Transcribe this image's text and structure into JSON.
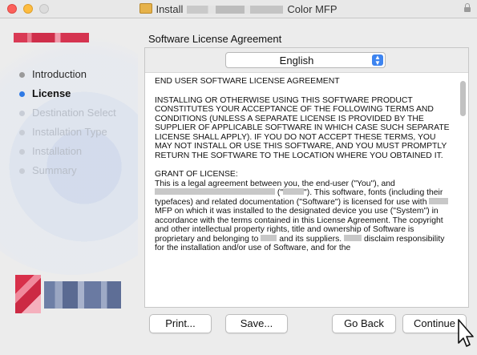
{
  "window": {
    "title_prefix": "Install",
    "title_suffix": "Color MFP"
  },
  "sidebar": {
    "steps": [
      {
        "label": "Introduction",
        "state": "done"
      },
      {
        "label": "License",
        "state": "current"
      },
      {
        "label": "Destination Select",
        "state": "future"
      },
      {
        "label": "Installation Type",
        "state": "future"
      },
      {
        "label": "Installation",
        "state": "future"
      },
      {
        "label": "Summary",
        "state": "future"
      }
    ]
  },
  "content": {
    "header": "Software License Agreement",
    "language_select": {
      "value": "English"
    },
    "license": {
      "heading": "END USER SOFTWARE LICENSE AGREEMENT",
      "para1": "INSTALLING OR OTHERWISE USING THIS SOFTWARE PRODUCT CONSTITUTES YOUR ACCEPTANCE OF THE FOLLOWING TERMS AND CONDITIONS (UNLESS A SEPARATE LICENSE IS PROVIDED BY THE SUPPLIER OF APPLICABLE SOFTWARE IN WHICH CASE SUCH SEPARATE LICENSE SHALL APPLY). IF YOU DO NOT ACCEPT THESE TERMS, YOU MAY NOT INSTALL OR USE THIS SOFTWARE, AND YOU MUST PROMPTLY RETURN THE SOFTWARE TO THE LOCATION WHERE YOU OBTAINED IT.",
      "grant_heading": "GRANT OF LICENSE:",
      "grant_1": "This is a legal agreement between you, the end-user (\"You\"), and",
      "grant_2": "(\"",
      "grant_3": "\"). This software, fonts (including their typefaces) and related documentation (\"Software\") is licensed for use with",
      "grant_4": "MFP  on which it was installed to the designated device you use (\"System\") in accordance with the terms contained in this License Agreement.  The copyright and other intellectual property rights, title and ownership of Software is proprietary and belonging to",
      "grant_5": "and its suppliers.",
      "grant_6": "disclaim responsibility for the installation and/or use of Software, and for the"
    }
  },
  "buttons": {
    "print": "Print...",
    "save": "Save...",
    "go_back": "Go Back",
    "continue": "Continue"
  },
  "colors": {
    "accent": "#2f7ae5",
    "close": "#fc605b",
    "minimize": "#fdbc40"
  }
}
